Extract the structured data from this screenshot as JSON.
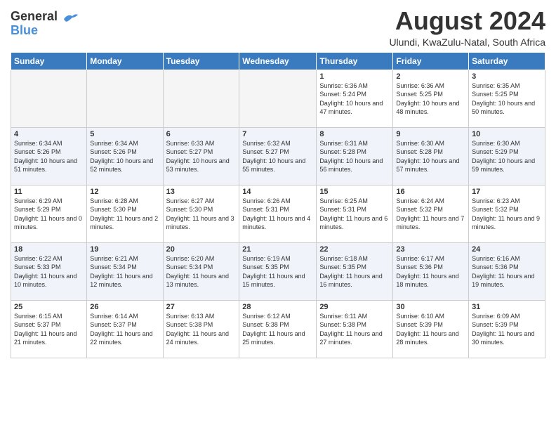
{
  "header": {
    "logo_general": "General",
    "logo_blue": "Blue",
    "month_year": "August 2024",
    "location": "Ulundi, KwaZulu-Natal, South Africa"
  },
  "weekdays": [
    "Sunday",
    "Monday",
    "Tuesday",
    "Wednesday",
    "Thursday",
    "Friday",
    "Saturday"
  ],
  "weeks": [
    [
      {
        "day": "",
        "empty": true
      },
      {
        "day": "",
        "empty": true
      },
      {
        "day": "",
        "empty": true
      },
      {
        "day": "",
        "empty": true
      },
      {
        "day": "1",
        "sunrise": "6:36 AM",
        "sunset": "5:24 PM",
        "daylight": "10 hours and 47 minutes."
      },
      {
        "day": "2",
        "sunrise": "6:36 AM",
        "sunset": "5:25 PM",
        "daylight": "10 hours and 48 minutes."
      },
      {
        "day": "3",
        "sunrise": "6:35 AM",
        "sunset": "5:25 PM",
        "daylight": "10 hours and 50 minutes."
      }
    ],
    [
      {
        "day": "4",
        "sunrise": "6:34 AM",
        "sunset": "5:26 PM",
        "daylight": "10 hours and 51 minutes."
      },
      {
        "day": "5",
        "sunrise": "6:34 AM",
        "sunset": "5:26 PM",
        "daylight": "10 hours and 52 minutes."
      },
      {
        "day": "6",
        "sunrise": "6:33 AM",
        "sunset": "5:27 PM",
        "daylight": "10 hours and 53 minutes."
      },
      {
        "day": "7",
        "sunrise": "6:32 AM",
        "sunset": "5:27 PM",
        "daylight": "10 hours and 55 minutes."
      },
      {
        "day": "8",
        "sunrise": "6:31 AM",
        "sunset": "5:28 PM",
        "daylight": "10 hours and 56 minutes."
      },
      {
        "day": "9",
        "sunrise": "6:30 AM",
        "sunset": "5:28 PM",
        "daylight": "10 hours and 57 minutes."
      },
      {
        "day": "10",
        "sunrise": "6:30 AM",
        "sunset": "5:29 PM",
        "daylight": "10 hours and 59 minutes."
      }
    ],
    [
      {
        "day": "11",
        "sunrise": "6:29 AM",
        "sunset": "5:29 PM",
        "daylight": "11 hours and 0 minutes."
      },
      {
        "day": "12",
        "sunrise": "6:28 AM",
        "sunset": "5:30 PM",
        "daylight": "11 hours and 2 minutes."
      },
      {
        "day": "13",
        "sunrise": "6:27 AM",
        "sunset": "5:30 PM",
        "daylight": "11 hours and 3 minutes."
      },
      {
        "day": "14",
        "sunrise": "6:26 AM",
        "sunset": "5:31 PM",
        "daylight": "11 hours and 4 minutes."
      },
      {
        "day": "15",
        "sunrise": "6:25 AM",
        "sunset": "5:31 PM",
        "daylight": "11 hours and 6 minutes."
      },
      {
        "day": "16",
        "sunrise": "6:24 AM",
        "sunset": "5:32 PM",
        "daylight": "11 hours and 7 minutes."
      },
      {
        "day": "17",
        "sunrise": "6:23 AM",
        "sunset": "5:32 PM",
        "daylight": "11 hours and 9 minutes."
      }
    ],
    [
      {
        "day": "18",
        "sunrise": "6:22 AM",
        "sunset": "5:33 PM",
        "daylight": "11 hours and 10 minutes."
      },
      {
        "day": "19",
        "sunrise": "6:21 AM",
        "sunset": "5:34 PM",
        "daylight": "11 hours and 12 minutes."
      },
      {
        "day": "20",
        "sunrise": "6:20 AM",
        "sunset": "5:34 PM",
        "daylight": "11 hours and 13 minutes."
      },
      {
        "day": "21",
        "sunrise": "6:19 AM",
        "sunset": "5:35 PM",
        "daylight": "11 hours and 15 minutes."
      },
      {
        "day": "22",
        "sunrise": "6:18 AM",
        "sunset": "5:35 PM",
        "daylight": "11 hours and 16 minutes."
      },
      {
        "day": "23",
        "sunrise": "6:17 AM",
        "sunset": "5:36 PM",
        "daylight": "11 hours and 18 minutes."
      },
      {
        "day": "24",
        "sunrise": "6:16 AM",
        "sunset": "5:36 PM",
        "daylight": "11 hours and 19 minutes."
      }
    ],
    [
      {
        "day": "25",
        "sunrise": "6:15 AM",
        "sunset": "5:37 PM",
        "daylight": "11 hours and 21 minutes."
      },
      {
        "day": "26",
        "sunrise": "6:14 AM",
        "sunset": "5:37 PM",
        "daylight": "11 hours and 22 minutes."
      },
      {
        "day": "27",
        "sunrise": "6:13 AM",
        "sunset": "5:38 PM",
        "daylight": "11 hours and 24 minutes."
      },
      {
        "day": "28",
        "sunrise": "6:12 AM",
        "sunset": "5:38 PM",
        "daylight": "11 hours and 25 minutes."
      },
      {
        "day": "29",
        "sunrise": "6:11 AM",
        "sunset": "5:38 PM",
        "daylight": "11 hours and 27 minutes."
      },
      {
        "day": "30",
        "sunrise": "6:10 AM",
        "sunset": "5:39 PM",
        "daylight": "11 hours and 28 minutes."
      },
      {
        "day": "31",
        "sunrise": "6:09 AM",
        "sunset": "5:39 PM",
        "daylight": "11 hours and 30 minutes."
      }
    ]
  ]
}
